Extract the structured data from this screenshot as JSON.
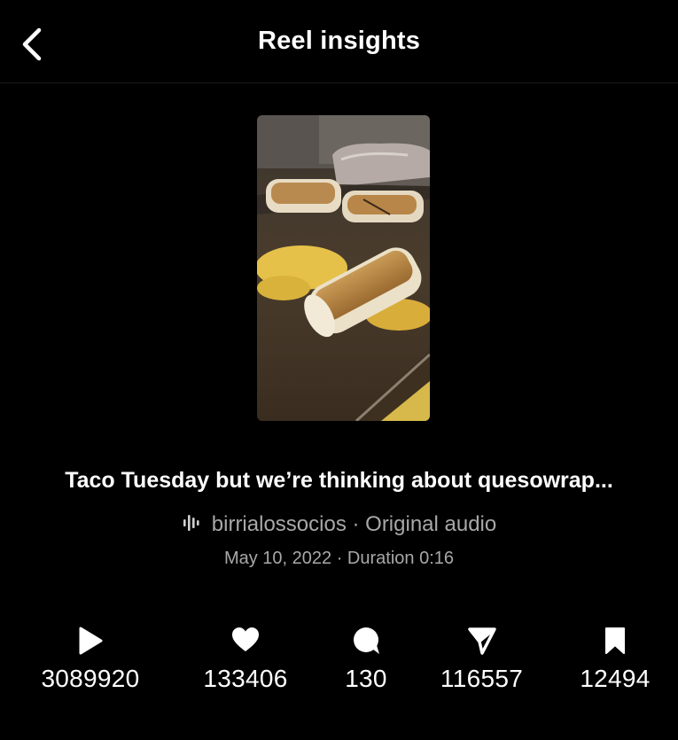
{
  "header": {
    "title": "Reel insights",
    "back_icon": "chevron-left-icon"
  },
  "reel": {
    "caption": "Taco Tuesday but we’re thinking about quesowrap...",
    "audio_icon": "audio-waveform-icon",
    "audio": "birrialossocios · Original audio",
    "date_duration": "May 10, 2022 · Duration 0:16"
  },
  "stats": [
    {
      "icon": "play-icon",
      "value": "3089920"
    },
    {
      "icon": "heart-icon",
      "value": "133406"
    },
    {
      "icon": "comment-icon",
      "value": "130"
    },
    {
      "icon": "share-icon",
      "value": "116557"
    },
    {
      "icon": "bookmark-icon",
      "value": "12494"
    }
  ],
  "colors": {
    "background": "#000000",
    "primary_text": "#ffffff",
    "secondary_text": "#a8a8a8"
  }
}
